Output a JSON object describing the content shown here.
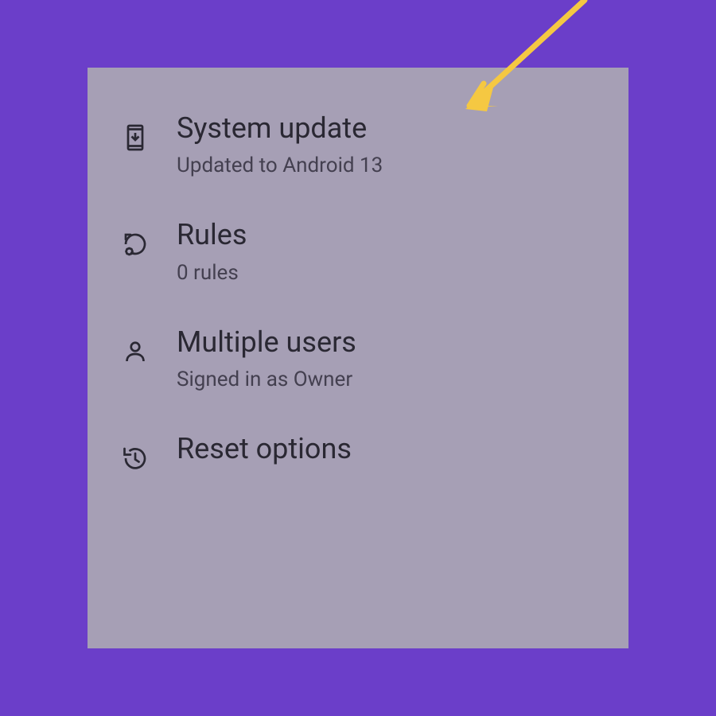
{
  "settings": {
    "items": [
      {
        "title": "System update",
        "subtitle": "Updated to Android 13"
      },
      {
        "title": "Rules",
        "subtitle": "0 rules"
      },
      {
        "title": "Multiple users",
        "subtitle": "Signed in as Owner"
      },
      {
        "title": "Reset options",
        "subtitle": ""
      }
    ]
  },
  "annotation": {
    "arrow_color": "#f5c842"
  }
}
